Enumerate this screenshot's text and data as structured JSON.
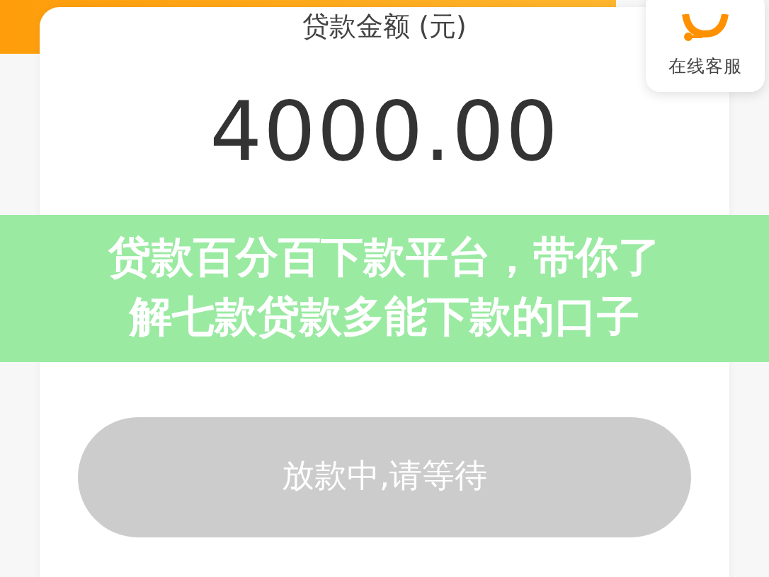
{
  "service_widget": {
    "label": "在线客服"
  },
  "loan_card": {
    "label": "贷款金额 (元)",
    "amount": "4000.00"
  },
  "overlay_banner": {
    "lines": [
      "贷款百分百下款平台，带你了",
      "解七款贷款多能下款的口子"
    ]
  },
  "action_button": {
    "label": "放款中,请等待",
    "disabled": true
  }
}
